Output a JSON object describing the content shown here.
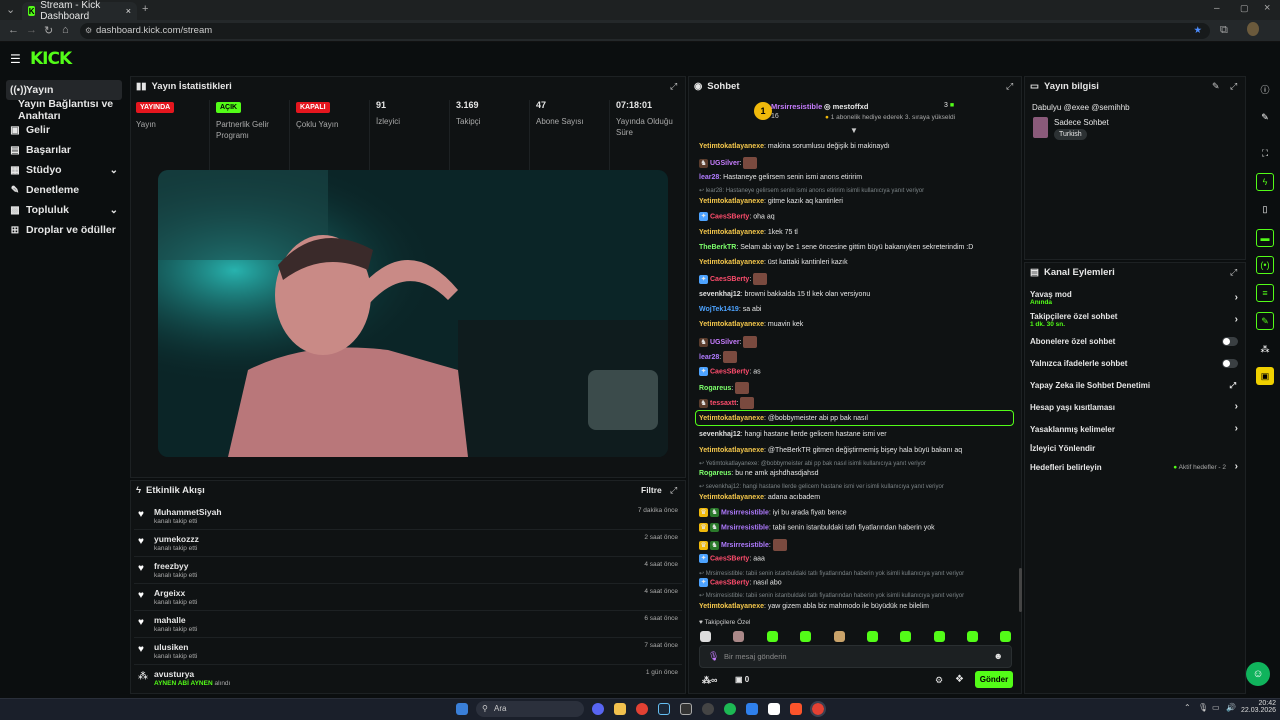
{
  "browser": {
    "tab_title": "Stream - Kick Dashboard",
    "url": "dashboard.kick.com/stream"
  },
  "app": {
    "logo": "KICK"
  },
  "sidebar": {
    "items": [
      {
        "label": "Yayın",
        "icon": "broadcast-icon"
      },
      {
        "label": "Yayın Bağlantısı ve Anahtarı",
        "icon": ""
      },
      {
        "label": "Gelir",
        "icon": "revenue-icon"
      },
      {
        "label": "Başarılar",
        "icon": "achievement-icon"
      },
      {
        "label": "Stüdyo",
        "icon": "studio-icon"
      },
      {
        "label": "Denetleme",
        "icon": "wrench-icon"
      },
      {
        "label": "Topluluk",
        "icon": "community-icon"
      },
      {
        "label": "Droplar ve ödüller",
        "icon": "gift-icon"
      }
    ]
  },
  "stats": {
    "title": "Yayın İstatistikleri",
    "cols": [
      {
        "badge": "YAYINDA",
        "label": "Yayın"
      },
      {
        "badge": "AÇIK",
        "label": "Partnerlik Gelir Programı"
      },
      {
        "badge": "KAPALI",
        "label": "Çoklu Yayın"
      },
      {
        "value": "91",
        "label": "İzleyici"
      },
      {
        "value": "3.169",
        "label": "Takipçi"
      },
      {
        "value": "47",
        "label": "Abone Sayısı"
      },
      {
        "value": "07:18:01",
        "label": "Yayında Olduğu Süre"
      }
    ]
  },
  "activity": {
    "title": "Etkinlik Akışı",
    "filter": "Filtre",
    "rows": [
      {
        "name": "MuhammetSiyah",
        "sub": "kanalı takip etti",
        "time": "7 dakika önce"
      },
      {
        "name": "yumekozzz",
        "sub": "kanalı takip etti",
        "time": "2 saat önce"
      },
      {
        "name": "freezbyy",
        "sub": "kanalı takip etti",
        "time": "4 saat önce"
      },
      {
        "name": "Argeixx",
        "sub": "kanalı takip etti",
        "time": "4 saat önce"
      },
      {
        "name": "mahalle",
        "sub": "kanalı takip etti",
        "time": "6 saat önce"
      },
      {
        "name": "ulusiken",
        "sub": "kanalı takip etti",
        "time": "7 saat önce"
      },
      {
        "name": "avusturya",
        "sub_green": "AYNEN ABİ AYNEN",
        "sub": "alındı",
        "time": "1 gün önce"
      }
    ]
  },
  "chat": {
    "title": "Sohbet",
    "pinned": {
      "user1": "Mrsirresistible",
      "count1": "16",
      "user2": "mestoffxd",
      "count2": "3",
      "note": "1 abonelik hediye ederek 3. sıraya yükseldi",
      "rank": "1"
    },
    "messages": [
      {
        "user": "Yetimtokatlayanexe",
        "color": "#f5c84c",
        "text": "makina sorumlusu değişik bi makinaydı"
      },
      {
        "user": "UGSilver",
        "color": "#c77dff",
        "text": ""
      },
      {
        "user": "lear28",
        "color": "#b07bff",
        "text": "Hastaneye gelirsem senin ismi anons etiririm"
      },
      {
        "reply": "lear28: Hastaneye gelirsem senin ismi anons etiririm isimli kullanıcıya yanıt veriyor"
      },
      {
        "user": "Yetimtokatlayanexe",
        "color": "#f5c84c",
        "text": "gitme kazık aq kantinleri"
      },
      {
        "user": "CaesSBerty",
        "color": "#ff4d6d",
        "text": "oha aq"
      },
      {
        "user": "Yetimtokatlayanexe",
        "color": "#f5c84c",
        "text": "1kek 75 tl"
      },
      {
        "user": "TheBerkTR",
        "color": "#7cff6b",
        "text": "Selam abi vay be 1 sene öncesine gittim büyü bakanıyken sekreterindim :D"
      },
      {
        "user": "Yetimtokatlayanexe",
        "color": "#f5c84c",
        "text": "üst kattaki kantinleri kazık"
      },
      {
        "user": "CaesSBerty",
        "color": "#ff4d6d",
        "text": ""
      },
      {
        "user": "sevenkhaj12",
        "color": "#e0e0e0",
        "text": "browni bakkalda 15 tl kek olan versiyonu"
      },
      {
        "user": "WojTek1419",
        "color": "#4da3ff",
        "text": "sa abi"
      },
      {
        "user": "Yetimtokatlayanexe",
        "color": "#f5c84c",
        "text": "muavin kek"
      },
      {
        "user": "UGSilver",
        "color": "#c77dff",
        "text": ""
      },
      {
        "user": "lear28",
        "color": "#b07bff",
        "text": ""
      },
      {
        "user": "CaesSBerty",
        "color": "#ff4d6d",
        "text": "as"
      },
      {
        "user": "Rogareus",
        "color": "#7cff6b",
        "text": ""
      },
      {
        "user": "tessaxtt",
        "color": "#ff4d6d",
        "text": ""
      },
      {
        "user": "Yetimtokatlayanexe",
        "color": "#f5c84c",
        "text": "@bobbymeister abi pp bak nasıl"
      },
      {
        "user": "sevenkhaj12",
        "color": "#e0e0e0",
        "text": "hangi hastane llerde gelicem hastane ismi ver"
      },
      {
        "user": "Yetimtokatlayanexe",
        "color": "#f5c84c",
        "text": "@TheBerkTR gitmen değiştirmemiş bişey hala büyü bakanı aq"
      },
      {
        "reply": "Yetimtokatlayanexe: @bobbymeister abi pp bak nasıl isimli kullanıcıya yanıt veriyor"
      },
      {
        "user": "Rogareus",
        "color": "#7cff6b",
        "text": "bu ne amk ajshdhasdjahsd"
      },
      {
        "reply": "sevenkhaj12: hangi hastane llerde gelicem hastane ismi ver isimli kullanıcıya yanıt veriyor"
      },
      {
        "user": "Yetimtokatlayanexe",
        "color": "#f5c84c",
        "text": "adana acıbadem"
      },
      {
        "user": "Mrsirresistible",
        "color": "#b07bff",
        "text": "iyi bu arada fiyatı bence"
      },
      {
        "user": "Mrsirresistible",
        "color": "#b07bff",
        "text": "tabii senin istanbuldaki tatlı fiyatlarından haberin yok"
      },
      {
        "user": "Mrsirresistible",
        "color": "#b07bff",
        "text": ""
      },
      {
        "user": "CaesSBerty",
        "color": "#ff4d6d",
        "text": "aaa"
      },
      {
        "reply": "Mrsirresistible: tabii senin istanbuldaki tatlı fiyatlarından haberin yok isimli kullanıcıya yanıt veriyor"
      },
      {
        "user": "CaesSBerty",
        "color": "#ff4d6d",
        "text": "nasıl abo"
      },
      {
        "reply": "Mrsirresistible: tabii senin istanbuldaki tatlı fiyatlarından haberin yok isimli kullanıcıya yanıt veriyor"
      },
      {
        "user": "Yetimtokatlayanexe",
        "color": "#f5c84c",
        "text": "yaw gizem abla biz mahmodo ile büyüdük ne bilelim"
      }
    ],
    "followers_label": "Takipçilere Özel",
    "input_placeholder": "Bir mesaj gönderin",
    "infinity": "∞",
    "count": "0",
    "send": "Gönder"
  },
  "stream_info": {
    "title": "Yayın bilgisi",
    "stream_title": "Dabulyu @exee @semihhb",
    "category": "Sadece Sohbet",
    "tag": "Turkish"
  },
  "channel_actions": {
    "title": "Kanal Eylemleri",
    "items": [
      {
        "label": "Yavaş mod",
        "sub": "Anında",
        "control": "arrow"
      },
      {
        "label": "Takipçilere özel sohbet",
        "sub": "1 dk. 30 sn.",
        "control": "arrow"
      },
      {
        "label": "Abonelere özel sohbet",
        "control": "toggle"
      },
      {
        "label": "Yalnızca ifadelerle sohbet",
        "control": "toggle"
      },
      {
        "label": "Yapay Zeka ile Sohbet Denetimi",
        "control": "ext"
      },
      {
        "label": "Hesap yaşı kısıtlaması",
        "control": "arrow"
      },
      {
        "label": "Yasaklanmış kelimeler",
        "control": "arrow"
      },
      {
        "label": "İzleyici Yönlendir",
        "control": "none"
      },
      {
        "label": "Hedefleri belirleyin",
        "control": "arrow",
        "status": "Aktif hedefler - 2"
      }
    ]
  },
  "taskbar": {
    "search": "Ara",
    "time": "20:42",
    "date": "22.03.2026"
  },
  "colors": {
    "accent": "#53fc18",
    "live": "#e5161e"
  }
}
